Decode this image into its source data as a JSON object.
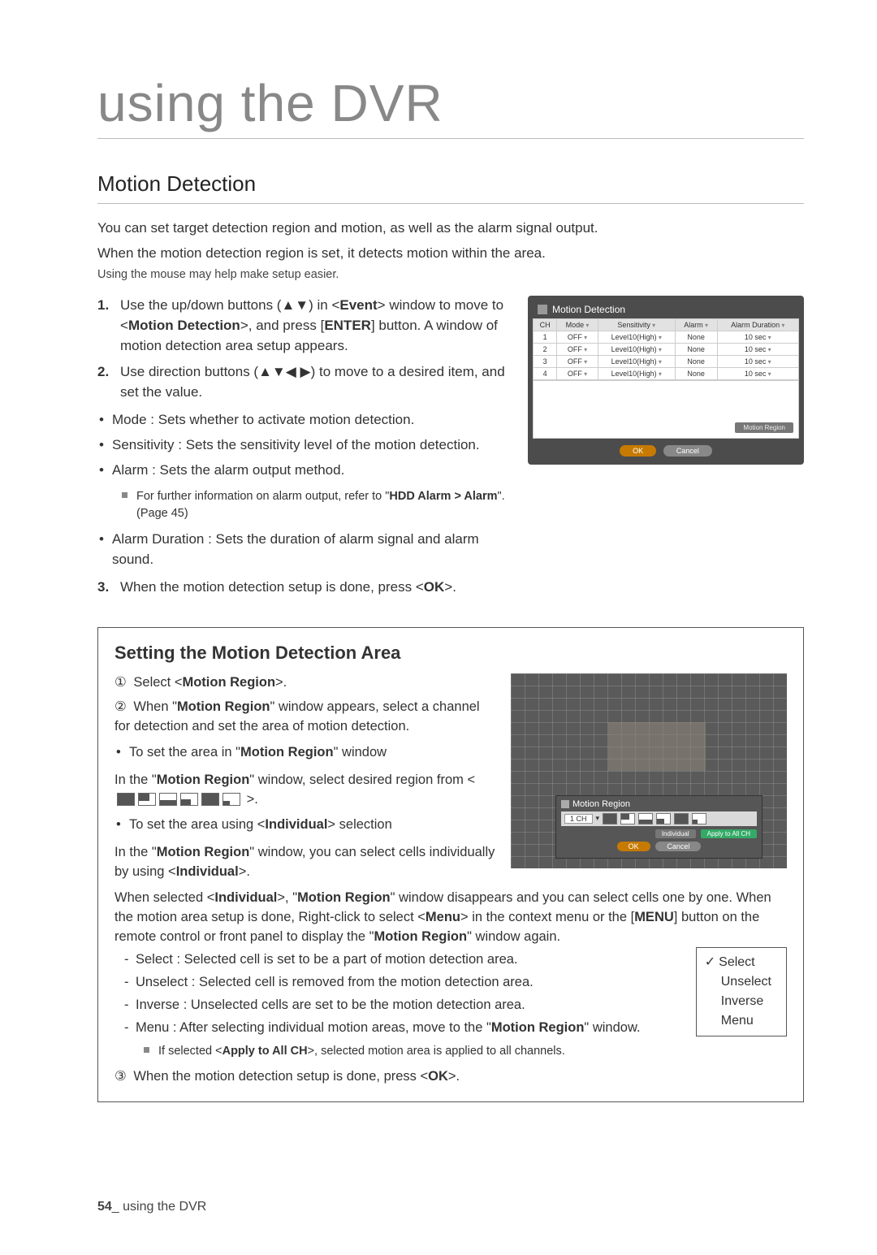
{
  "chapter_title": "using the DVR",
  "section_title": "Motion Detection",
  "intro_lines": [
    "You can set target detection region and motion, as well as the alarm signal output.",
    "When the motion detection region is set, it detects motion within the area."
  ],
  "mouse_note": "Using the mouse may help make setup easier.",
  "step1": {
    "num": "1.",
    "l1a": "Use the up/down buttons (▲▼) in <",
    "l1b": "Event",
    "l1c": "> window to move to <",
    "l1d": "Motion Detection",
    "l1e": ">, and press [",
    "l1f": "ENTER",
    "l1g": "] button. A window of motion detection area setup appears."
  },
  "step2": {
    "num": "2.",
    "text": "Use direction buttons (▲▼◀ ▶) to move to a desired item, and set the value."
  },
  "bul_mode": "Mode : Sets whether to activate motion detection.",
  "bul_sens": "Sensitivity : Sets the sensitivity level of the motion detection.",
  "bul_alarm": "Alarm : Sets the alarm output method.",
  "alarm_sub_a": "For further information on alarm output, refer to \"",
  "alarm_sub_b": "HDD Alarm > Alarm",
  "alarm_sub_c": "\". (Page 45)",
  "bul_dur": "Alarm Duration : Sets the duration of alarm signal and alarm sound.",
  "step3": {
    "num": "3.",
    "a": "When the motion detection setup is done, press <",
    "b": "OK",
    "c": ">."
  },
  "ui": {
    "title": "Motion Detection",
    "headers": {
      "ch": "CH",
      "mode": "Mode",
      "sens": "Sensitivity",
      "alarm": "Alarm",
      "dur": "Alarm Duration"
    },
    "rows": [
      {
        "ch": "1",
        "mode": "OFF",
        "sens": "Level10(High)",
        "alarm": "None",
        "dur": "10 sec"
      },
      {
        "ch": "2",
        "mode": "OFF",
        "sens": "Level10(High)",
        "alarm": "None",
        "dur": "10 sec"
      },
      {
        "ch": "3",
        "mode": "OFF",
        "sens": "Level10(High)",
        "alarm": "None",
        "dur": "10 sec"
      },
      {
        "ch": "4",
        "mode": "OFF",
        "sens": "Level10(High)",
        "alarm": "None",
        "dur": "10 sec"
      }
    ],
    "motion_region_btn": "Motion Region",
    "ok": "OK",
    "cancel": "Cancel"
  },
  "box": {
    "title": "Setting the Motion Detection Area",
    "s1": {
      "num": "①",
      "a": "Select <",
      "b": "Motion Region",
      "c": ">."
    },
    "s2": {
      "num": "②",
      "a": "When \"",
      "b": "Motion Region",
      "c": "\" window appears, select a channel for detection and set the area of motion detection."
    },
    "bul1": {
      "a": "To set the area in \"",
      "b": "Motion Region",
      "c": "\" window"
    },
    "p1": {
      "a": "In the \"",
      "b": "Motion Region",
      "c": "\" window, select desired region from <",
      "d": ">."
    },
    "bul2": {
      "a": "To set the area using <",
      "b": "Individual",
      "c": "> selection"
    },
    "p2": {
      "a": "In the \"",
      "b": "Motion Region",
      "c": "\" window, you can select cells individually by using <",
      "d": "Individual",
      "e": ">."
    },
    "p3": {
      "a": "When selected <",
      "b": "Individual",
      "c": ">, \"",
      "d": "Motion Region",
      "e": "\" window disappears and you can select cells one by one. When the motion area setup is done, Right-click to select <",
      "f": "Menu",
      "g": "> in the context menu or the [",
      "h": "MENU",
      "i": "] button on the remote control or front panel to display the \"",
      "j": "Motion Region",
      "k": "\" window again."
    },
    "dash": {
      "select": "Select : Selected cell is set to be a part of motion detection area.",
      "unselect": "Unselect : Selected cell is removed from the motion detection area.",
      "inverse": "Inverse : Unselected cells are set to be the motion detection area.",
      "menu_a": "Menu : After selecting individual motion areas, move to the \"",
      "menu_b": "Motion Region",
      "menu_c": "\" window."
    },
    "apply_note": {
      "a": "If selected <",
      "b": "Apply to All CH",
      "c": ">, selected motion area is applied to all channels."
    },
    "s3": {
      "num": "③",
      "a": "When the motion detection setup is done, press <",
      "b": "OK",
      "c": ">."
    },
    "ctx": {
      "select": "Select",
      "unselect": "Unselect",
      "inverse": "Inverse",
      "menu": "Menu",
      "check": "✓"
    },
    "mr": {
      "title": "Motion Region",
      "ch": "1 CH",
      "individual": "Individual",
      "apply": "Apply to All CH",
      "ok": "OK",
      "cancel": "Cancel"
    }
  },
  "footer": {
    "num": "54",
    "sep": "_ ",
    "text": "using the DVR"
  }
}
